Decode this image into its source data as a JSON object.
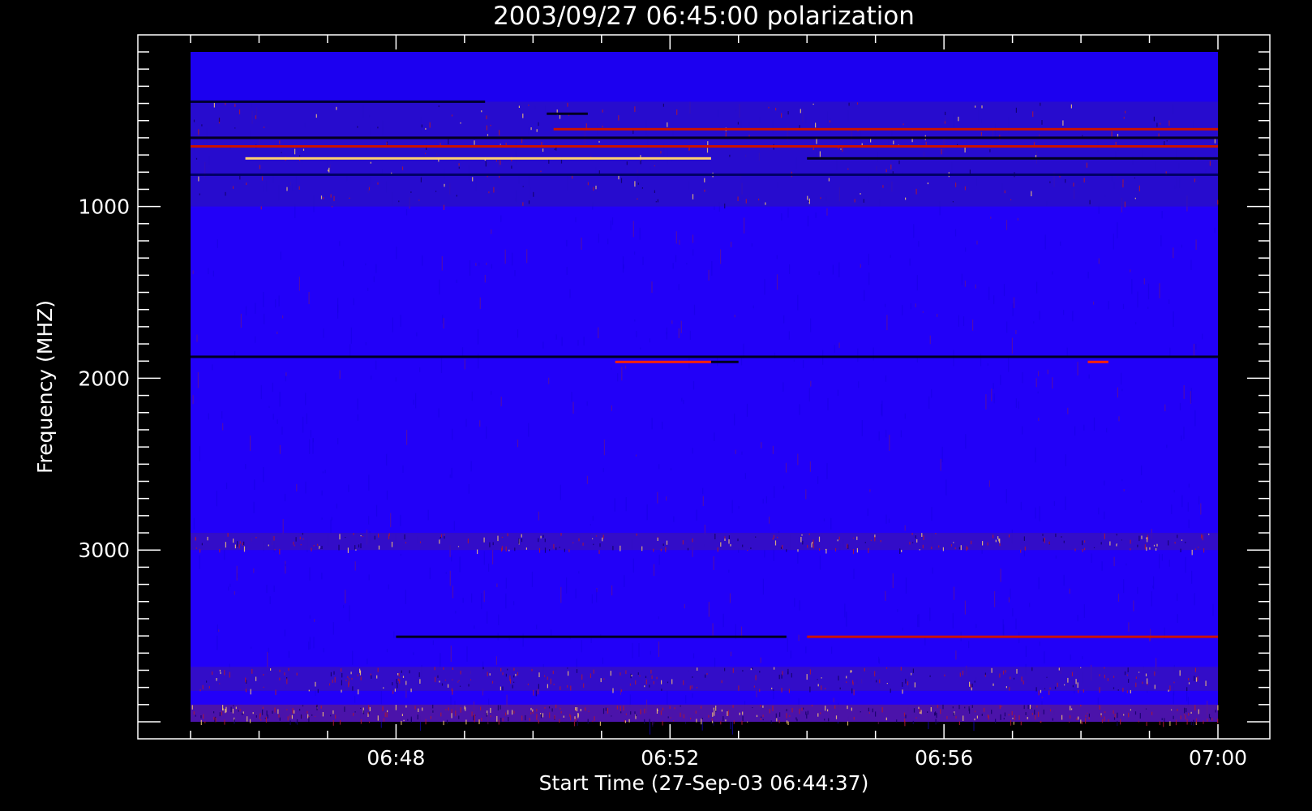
{
  "chart_data": {
    "type": "heatmap",
    "title": "2003/09/27 06:45:00 polarization",
    "xlabel": "Start Time (27-Sep-03 06:44:37)",
    "ylabel": "Frequency (MHZ)",
    "x_ticks": [
      {
        "label": "06:48",
        "minute": 48
      },
      {
        "label": "06:52",
        "minute": 52
      },
      {
        "label": "06:56",
        "minute": 56
      },
      {
        "label": "07:00",
        "minute": 60
      }
    ],
    "y_ticks": [
      {
        "label": "1000",
        "value": 1000
      },
      {
        "label": "2000",
        "value": 2000
      },
      {
        "label": "3000",
        "value": 3000
      }
    ],
    "x_range_minutes": [
      45,
      60
    ],
    "y_range": [
      100,
      4000
    ],
    "y_inverted": true,
    "colors": {
      "background": "#000000",
      "base": "#2200f8",
      "noise": "#1500e0",
      "dark": "#000033",
      "red": "#ff1a00",
      "yellow": "#ffe08a"
    },
    "features": [
      {
        "kind": "band",
        "f0": 100,
        "f1": 390,
        "color": "#1c00f0"
      },
      {
        "kind": "band",
        "f0": 390,
        "f1": 1000,
        "color": "#2a10c0",
        "noise": 0.55
      },
      {
        "kind": "line",
        "freq": 390,
        "t0": 45,
        "t1": 49.3,
        "color": "#000033"
      },
      {
        "kind": "line",
        "freq": 460,
        "t0": 50.2,
        "t1": 50.8,
        "color": "#000022"
      },
      {
        "kind": "line",
        "freq": 550,
        "t0": 50.3,
        "t1": 60,
        "color": "#cc1100"
      },
      {
        "kind": "line",
        "freq": 600,
        "t0": 45,
        "t1": 60,
        "color": "#050020"
      },
      {
        "kind": "line",
        "freq": 650,
        "t0": 45,
        "t1": 60,
        "color": "#cc1100"
      },
      {
        "kind": "line",
        "freq": 720,
        "t0": 45.8,
        "t1": 52.6,
        "color": "#ffd070"
      },
      {
        "kind": "line",
        "freq": 720,
        "t0": 54,
        "t1": 60,
        "color": "#000022"
      },
      {
        "kind": "line",
        "freq": 815,
        "t0": 45,
        "t1": 60,
        "color": "#000066"
      },
      {
        "kind": "line",
        "freq": 1875,
        "t0": 45,
        "t1": 60,
        "color": "#000022"
      },
      {
        "kind": "line",
        "freq": 1905,
        "t0": 51.2,
        "t1": 52.6,
        "color": "#ff2200"
      },
      {
        "kind": "line",
        "freq": 1905,
        "t0": 58.1,
        "t1": 58.4,
        "color": "#ff2200"
      },
      {
        "kind": "line",
        "freq": 1905,
        "t0": 52.6,
        "t1": 53,
        "color": "#000022"
      },
      {
        "kind": "band",
        "f0": 2900,
        "f1": 3000,
        "color": "#3a12b8",
        "noise": 0.5
      },
      {
        "kind": "line",
        "freq": 3505,
        "t0": 48,
        "t1": 53.7,
        "color": "#000020"
      },
      {
        "kind": "line",
        "freq": 3505,
        "t0": 54,
        "t1": 60,
        "color": "#cc1100"
      },
      {
        "kind": "band",
        "f0": 3680,
        "f1": 3820,
        "color": "#3a12b8",
        "noise": 0.6
      },
      {
        "kind": "band",
        "f0": 3900,
        "f1": 4000,
        "color": "#5a1a90",
        "noise": 0.9
      }
    ]
  }
}
